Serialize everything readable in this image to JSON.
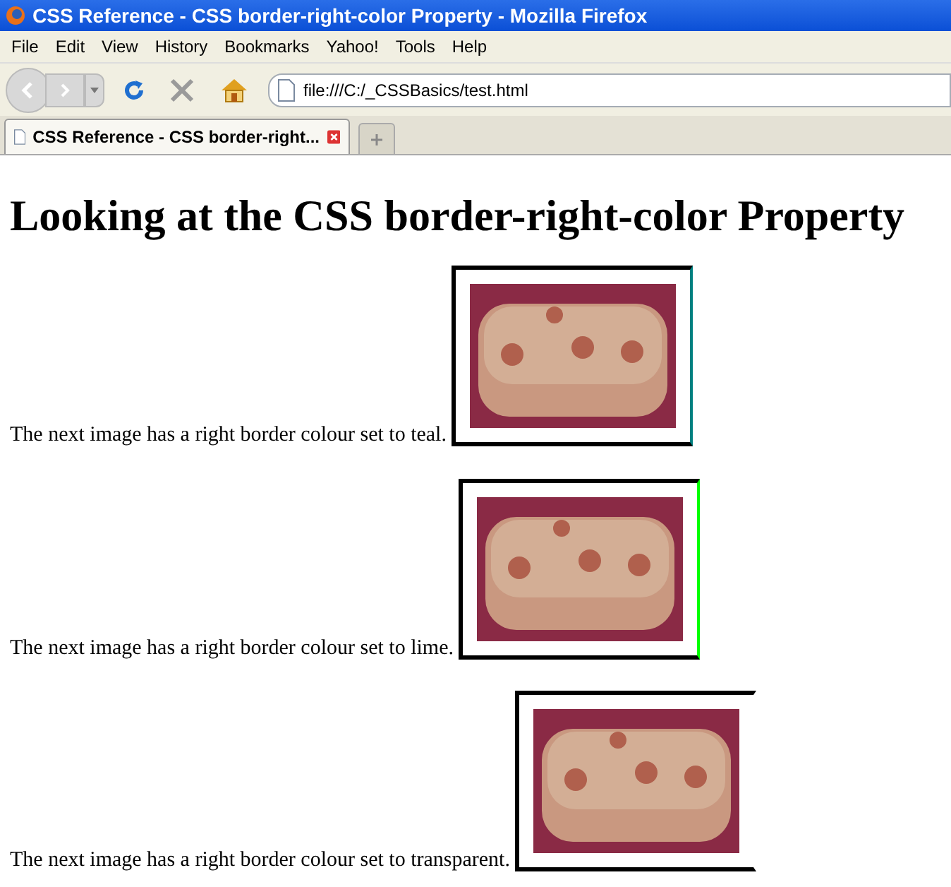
{
  "window": {
    "title": "CSS Reference - CSS border-right-color Property - Mozilla Firefox"
  },
  "menu": [
    "File",
    "Edit",
    "View",
    "History",
    "Bookmarks",
    "Yahoo!",
    "Tools",
    "Help"
  ],
  "address_bar": {
    "value": "file:///C:/_CSSBasics/test.html"
  },
  "tabs": [
    {
      "label": "CSS Reference - CSS border-right...",
      "selected": true
    }
  ],
  "page": {
    "heading": "Looking at the CSS border-right-color Property",
    "rows": [
      {
        "text": "The next image has a right border colour set to teal.",
        "color": "#008080",
        "transparent": false
      },
      {
        "text": "The next image has a right border colour set to lime.",
        "color": "#00ff00",
        "transparent": false
      },
      {
        "text": "The next image has a right border colour set to transparent.",
        "transparent": true
      }
    ]
  }
}
